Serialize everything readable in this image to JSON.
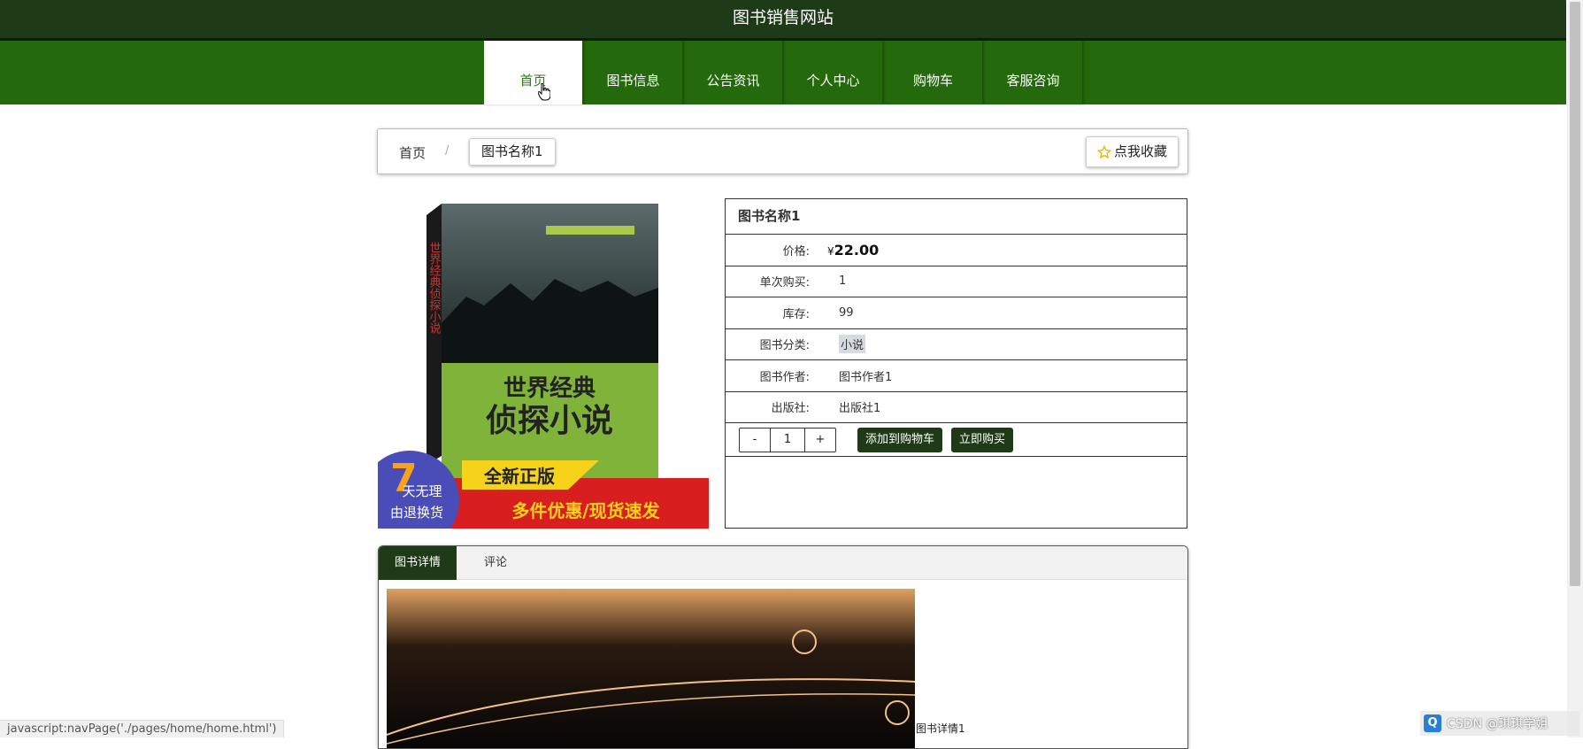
{
  "site": {
    "title": "图书销售网站"
  },
  "nav": {
    "items": [
      {
        "label": "首页"
      },
      {
        "label": "图书信息"
      },
      {
        "label": "公告资讯"
      },
      {
        "label": "个人中心"
      },
      {
        "label": "购物车"
      },
      {
        "label": "客服咨询"
      }
    ]
  },
  "breadcrumb": {
    "home": "首页",
    "separator": "/",
    "current": "图书名称1"
  },
  "favorite": {
    "label": "点我收藏",
    "icon": "star-icon"
  },
  "cover": {
    "title": "世界经典侦探小说",
    "vertical_title": "世界经典侦探小说",
    "banner_top": "全新正版",
    "banner_bottom": "多件优惠/现货速发",
    "badge_number": "7",
    "badge_line1": "天无理",
    "badge_line2": "由退换货"
  },
  "book": {
    "name": "图书名称1",
    "price_label": "价格:",
    "currency": "¥",
    "price": "22.00",
    "single_buy_label": "单次购买:",
    "single_buy": "1",
    "stock_label": "库存:",
    "stock": "99",
    "category_label": "图书分类:",
    "category": "小说",
    "author_label": "图书作者:",
    "author": "图书作者1",
    "publisher_label": "出版社:",
    "publisher": "出版社1"
  },
  "actions": {
    "minus": "-",
    "quantity": "1",
    "plus": "+",
    "add_to_cart": "添加到购物车",
    "buy_now": "立即购买"
  },
  "tabs": [
    {
      "label": "图书详情"
    },
    {
      "label": "评论"
    }
  ],
  "detail": {
    "caption": "图书详情1"
  },
  "status_bar": {
    "text": "javascript:navPage('./pages/home/home.html')"
  },
  "watermark": {
    "text": "CSDN @琪琪学姐"
  },
  "colors": {
    "header": "#1e3a16",
    "nav": "#246a0c",
    "active_text": "#2e7d16"
  }
}
